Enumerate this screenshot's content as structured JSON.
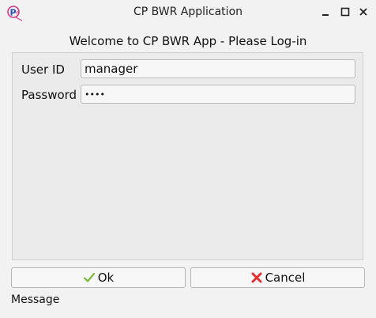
{
  "window": {
    "title": "CP BWR Application",
    "icon": "cpbwr-logo-icon"
  },
  "header": {
    "welcome": "Welcome to CP BWR App - Please Log-in"
  },
  "form": {
    "user_id_label": "User ID",
    "user_id_value": "manager",
    "password_label": "Password",
    "password_value": "••••"
  },
  "buttons": {
    "ok_label": "Ok",
    "cancel_label": "Cancel"
  },
  "status": {
    "message": "Message"
  },
  "colors": {
    "ok_check": "#7ab83a",
    "cancel_x": "#e03030"
  }
}
